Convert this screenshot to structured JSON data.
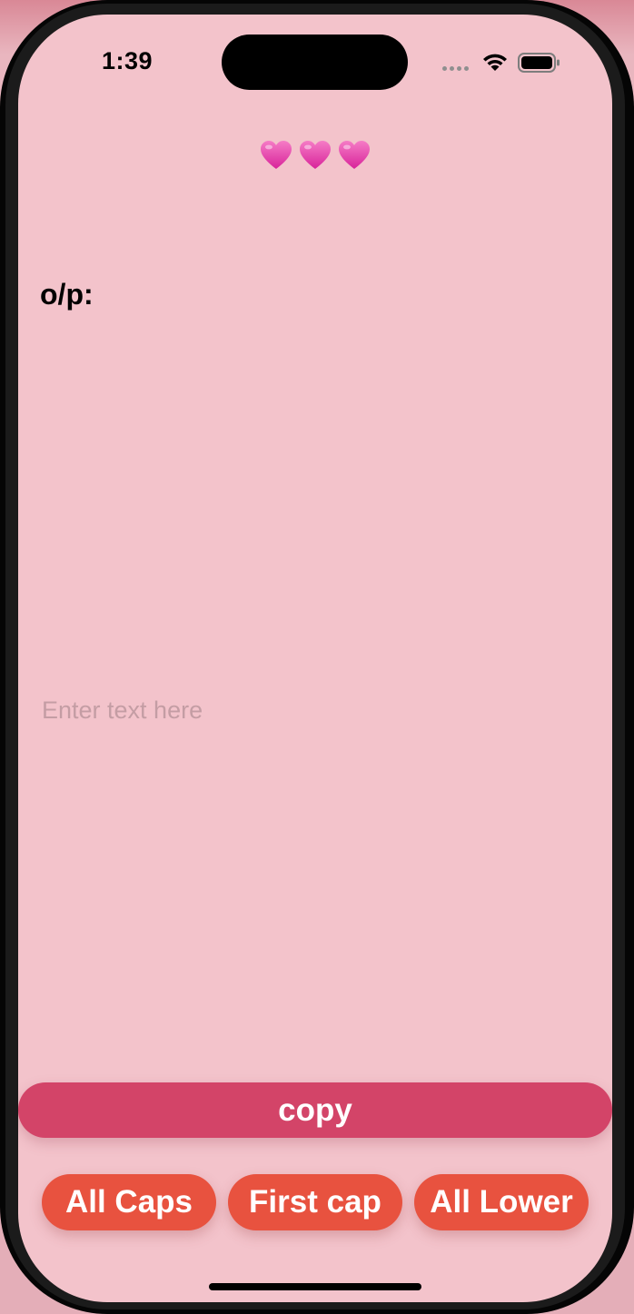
{
  "status_bar": {
    "time": "1:39",
    "icons": [
      "cellular-signal-icon",
      "wifi-icon",
      "battery-icon"
    ]
  },
  "header": {
    "emoji": [
      "heart-icon",
      "heart-icon",
      "heart-icon"
    ],
    "heart_color": "#e23fa0"
  },
  "output": {
    "label": "o/p:",
    "value": ""
  },
  "input": {
    "placeholder": "Enter text here",
    "value": ""
  },
  "actions": {
    "copy_label": "copy",
    "copy_color": "#d34468",
    "case_buttons": [
      {
        "label": "All Caps"
      },
      {
        "label": "First cap"
      },
      {
        "label": "All Lower"
      }
    ],
    "case_color": "#e8523f"
  },
  "colors": {
    "screen_background": "#f3c3cb",
    "placeholder": "#c49da4"
  }
}
